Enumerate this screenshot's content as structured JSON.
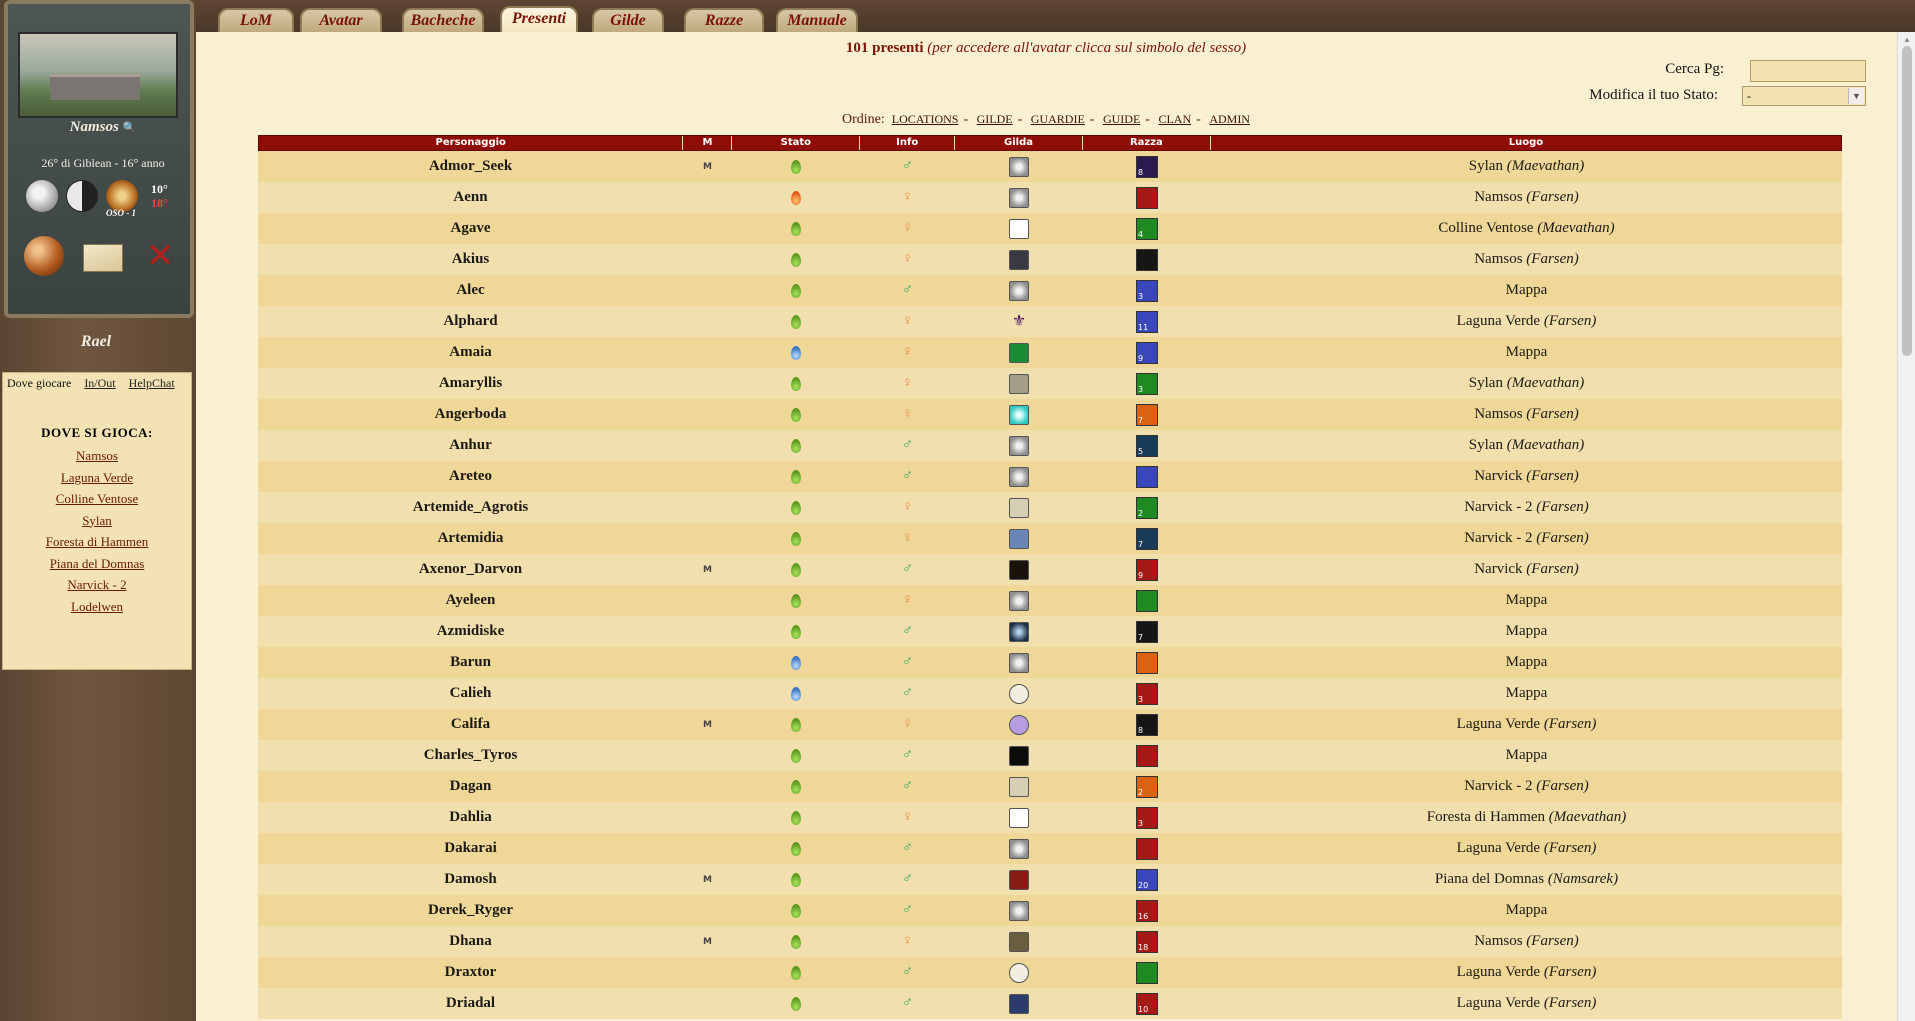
{
  "tabs": [
    "LoM",
    "Avatar",
    "Bacheche",
    "Presenti",
    "Gilde",
    "Razze",
    "Manuale"
  ],
  "active_tab": "Presenti",
  "sidebar": {
    "city_name": "Namsos",
    "date": "26° di Giblean - 16° anno",
    "temp_high": "10°",
    "temp_low": "18°",
    "wind": "OSO - 1",
    "user_name": "Rael",
    "where_tabs": {
      "active": "Dove giocare",
      "inout": "In/Out",
      "helpchat": "HelpChat"
    },
    "where_title": "DOVE SI GIOCA:",
    "locations": [
      "Namsos",
      "Laguna Verde",
      "Colline Ventose",
      "Sylan",
      "Foresta di Hammen",
      "Piana del Domnas",
      "Narvick - 2",
      "Lodelwen"
    ]
  },
  "header": {
    "count": "101 presenti",
    "note": "(per accedere all'avatar clicca sul simbolo del sesso)",
    "search_label": "Cerca Pg:",
    "search_value": "",
    "state_label": "Modifica il tuo Stato:",
    "state_value": "-"
  },
  "order": {
    "label": "Ordine:",
    "links": [
      "LOCATIONS",
      "GILDE",
      "GUARDIE",
      "GUIDE",
      "CLAN",
      "ADMIN"
    ]
  },
  "table": {
    "columns": [
      "Personaggio",
      "M",
      "Stato",
      "Info",
      "Gilda",
      "Razza",
      "Luogo"
    ],
    "rows": [
      {
        "name": "Admor_Seek",
        "m": "M",
        "stato": "green",
        "sex": "m",
        "gilda": "g-default",
        "razza": "r-purple",
        "rnum": "8",
        "luogo": "Sylan",
        "region": "(Maevathan)"
      },
      {
        "name": "Aenn",
        "m": "",
        "stato": "orange",
        "sex": "f",
        "gilda": "g-default",
        "razza": "r-red",
        "rnum": "",
        "luogo": "Namsos",
        "region": "(Farsen)"
      },
      {
        "name": "Agave",
        "m": "",
        "stato": "green",
        "sex": "f",
        "gilda": "g-tri",
        "razza": "r-green",
        "rnum": "4",
        "luogo": "Colline Ventose",
        "region": "(Maevathan)"
      },
      {
        "name": "Akius",
        "m": "",
        "stato": "green",
        "sex": "f",
        "gilda": "g-dark",
        "razza": "r-black",
        "rnum": "",
        "luogo": "Namsos",
        "region": "(Farsen)"
      },
      {
        "name": "Alec",
        "m": "",
        "stato": "green",
        "sex": "m",
        "gilda": "g-default",
        "razza": "r-blue",
        "rnum": "3",
        "luogo": "Mappa",
        "region": ""
      },
      {
        "name": "Alphard",
        "m": "",
        "stato": "green",
        "sex": "f",
        "gilda": "g-lily",
        "razza": "r-blue",
        "rnum": "11",
        "luogo": "Laguna Verde",
        "region": "(Farsen)"
      },
      {
        "name": "Amaia",
        "m": "",
        "stato": "blue",
        "sex": "f",
        "gilda": "g-green",
        "razza": "r-blue",
        "rnum": "9",
        "luogo": "Mappa",
        "region": ""
      },
      {
        "name": "Amaryllis",
        "m": "",
        "stato": "green",
        "sex": "f",
        "gilda": "g-lens",
        "razza": "r-green",
        "rnum": "3",
        "luogo": "Sylan",
        "region": "(Maevathan)"
      },
      {
        "name": "Angerboda",
        "m": "",
        "stato": "green",
        "sex": "f",
        "gilda": "g-cyan",
        "razza": "r-orange",
        "rnum": "7",
        "luogo": "Namsos",
        "region": "(Farsen)"
      },
      {
        "name": "Anhur",
        "m": "",
        "stato": "green",
        "sex": "m",
        "gilda": "g-default",
        "razza": "r-teal",
        "rnum": "5",
        "luogo": "Sylan",
        "region": "(Maevathan)"
      },
      {
        "name": "Areteo",
        "m": "",
        "stato": "green",
        "sex": "m",
        "gilda": "g-default",
        "razza": "r-blue",
        "rnum": "",
        "luogo": "Narvick",
        "region": "(Farsen)"
      },
      {
        "name": "Artemide_Agrotis",
        "m": "",
        "stato": "green",
        "sex": "f",
        "gilda": "g-beige",
        "razza": "r-green",
        "rnum": "2",
        "luogo": "Narvick - 2",
        "region": "(Farsen)"
      },
      {
        "name": "Artemidia",
        "m": "",
        "stato": "green",
        "sex": "f",
        "gilda": "g-blue",
        "razza": "r-teal",
        "rnum": "7",
        "luogo": "Narvick - 2",
        "region": "(Farsen)"
      },
      {
        "name": "Axenor_Darvon",
        "m": "M",
        "stato": "green",
        "sex": "m",
        "gilda": "g-moon",
        "razza": "r-red",
        "rnum": "9",
        "luogo": "Narvick",
        "region": "(Farsen)"
      },
      {
        "name": "Ayeleen",
        "m": "",
        "stato": "green",
        "sex": "f",
        "gilda": "g-default",
        "razza": "r-green",
        "rnum": "",
        "luogo": "Mappa",
        "region": ""
      },
      {
        "name": "Azmidiske",
        "m": "",
        "stato": "green",
        "sex": "m",
        "gilda": "g-orb",
        "razza": "r-black",
        "rnum": "7",
        "luogo": "Mappa",
        "region": ""
      },
      {
        "name": "Barun",
        "m": "",
        "stato": "blue",
        "sex": "m",
        "gilda": "g-default",
        "razza": "r-orange",
        "rnum": "",
        "luogo": "Mappa",
        "region": ""
      },
      {
        "name": "Calieh",
        "m": "",
        "stato": "blue",
        "sex": "m",
        "gilda": "g-eye",
        "razza": "r-red",
        "rnum": "3",
        "luogo": "Mappa",
        "region": ""
      },
      {
        "name": "Califa",
        "m": "M",
        "stato": "green",
        "sex": "f",
        "gilda": "g-purple",
        "razza": "r-black",
        "rnum": "8",
        "luogo": "Laguna Verde",
        "region": "(Farsen)"
      },
      {
        "name": "Charles_Tyros",
        "m": "",
        "stato": "green",
        "sex": "m",
        "gilda": "g-dot",
        "razza": "r-red",
        "rnum": "",
        "luogo": "Mappa",
        "region": ""
      },
      {
        "name": "Dagan",
        "m": "",
        "stato": "green",
        "sex": "m",
        "gilda": "g-beige",
        "razza": "r-orange",
        "rnum": "2",
        "luogo": "Narvick - 2",
        "region": "(Farsen)"
      },
      {
        "name": "Dahlia",
        "m": "",
        "stato": "green",
        "sex": "f",
        "gilda": "g-tri",
        "razza": "r-red",
        "rnum": "3",
        "luogo": "Foresta di Hammen",
        "region": "(Maevathan)"
      },
      {
        "name": "Dakarai",
        "m": "",
        "stato": "green",
        "sex": "m",
        "gilda": "g-default",
        "razza": "r-red",
        "rnum": "",
        "luogo": "Laguna Verde",
        "region": "(Farsen)"
      },
      {
        "name": "Damosh",
        "m": "M",
        "stato": "green",
        "sex": "m",
        "gilda": "g-red",
        "razza": "r-blue",
        "rnum": "20",
        "luogo": "Piana del Domnas",
        "region": "(Namsarek)"
      },
      {
        "name": "Derek_Ryger",
        "m": "",
        "stato": "green",
        "sex": "m",
        "gilda": "g-default",
        "razza": "r-red",
        "rnum": "16",
        "luogo": "Mappa",
        "region": ""
      },
      {
        "name": "Dhana",
        "m": "M",
        "stato": "green",
        "sex": "f",
        "gilda": "g-bronze",
        "razza": "r-red",
        "rnum": "18",
        "luogo": "Namsos",
        "region": "(Farsen)"
      },
      {
        "name": "Draxtor",
        "m": "",
        "stato": "green",
        "sex": "m",
        "gilda": "g-eye",
        "razza": "r-green",
        "rnum": "",
        "luogo": "Laguna Verde",
        "region": "(Farsen)"
      },
      {
        "name": "Driadal",
        "m": "",
        "stato": "green",
        "sex": "m",
        "gilda": "g-navy",
        "razza": "r-red",
        "rnum": "10",
        "luogo": "Laguna Verde",
        "region": "(Farsen)"
      }
    ]
  }
}
